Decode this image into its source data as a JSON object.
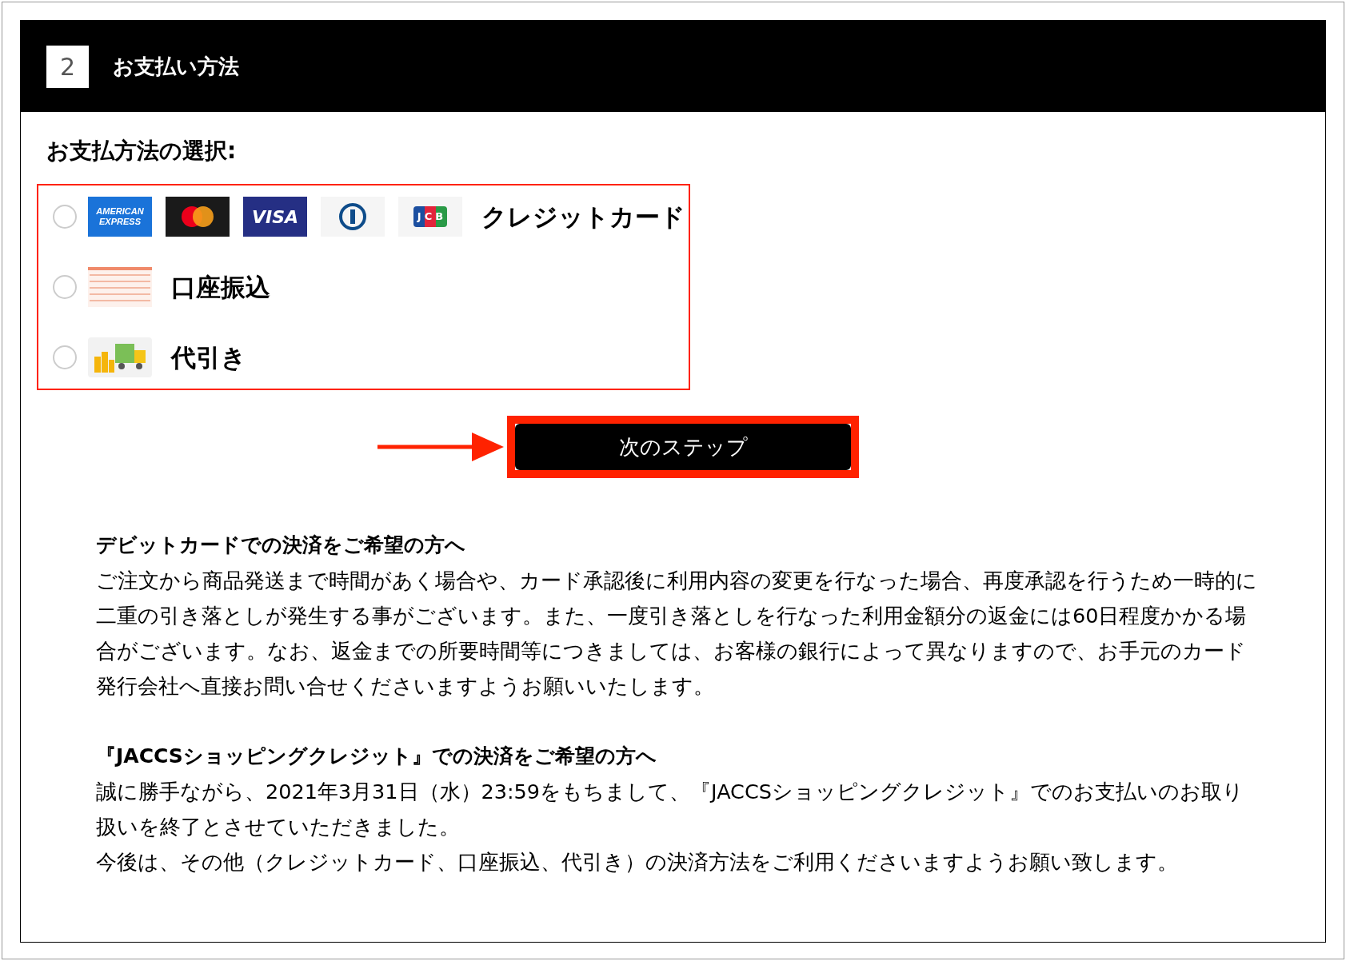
{
  "section": {
    "number": "2",
    "title": "お支払い方法"
  },
  "prompt": "お支払方法の選択:",
  "options": [
    {
      "kind": "card",
      "label": "クレジットカード",
      "selected": false,
      "logos": [
        {
          "kind": "amex",
          "text": "AMERICAN EXPRESS"
        },
        {
          "kind": "mastercard"
        },
        {
          "kind": "visa",
          "text": "VISA"
        },
        {
          "kind": "diners"
        },
        {
          "kind": "jcb",
          "text": "JCB"
        }
      ]
    },
    {
      "kind": "bank",
      "label": "口座振込",
      "selected": false
    },
    {
      "kind": "cod",
      "label": "代引き",
      "selected": false
    }
  ],
  "next_button": "次のステップ",
  "notices": [
    {
      "heading": "デビットカードでの決済をご希望の方へ",
      "paragraphs": [
        "ご注文から商品発送まで時間があく場合や、カード承認後に利用内容の変更を行なった場合、再度承認を行うため一時的に二重の引き落としが発生する事がございます。また、一度引き落としを行なった利用金額分の返金には60日程度かかる場合がございます。なお、返金までの所要時間等につきましては、お客様の銀行によって異なりますので、お手元のカード発行会社へ直接お問い合せくださいますようお願いいたします。"
      ]
    },
    {
      "heading": "『JACCSショッピングクレジット』での決済をご希望の方へ",
      "paragraphs": [
        "誠に勝手ながら、2021年3月31日（水）23:59をもちまして、『JACCSショッピングクレジット』でのお支払いのお取り扱いを終了とさせていただきました。",
        "今後は、その他（クレジットカード、口座振込、代引き）の決済方法をご利用くださいますようお願い致します。"
      ]
    }
  ]
}
